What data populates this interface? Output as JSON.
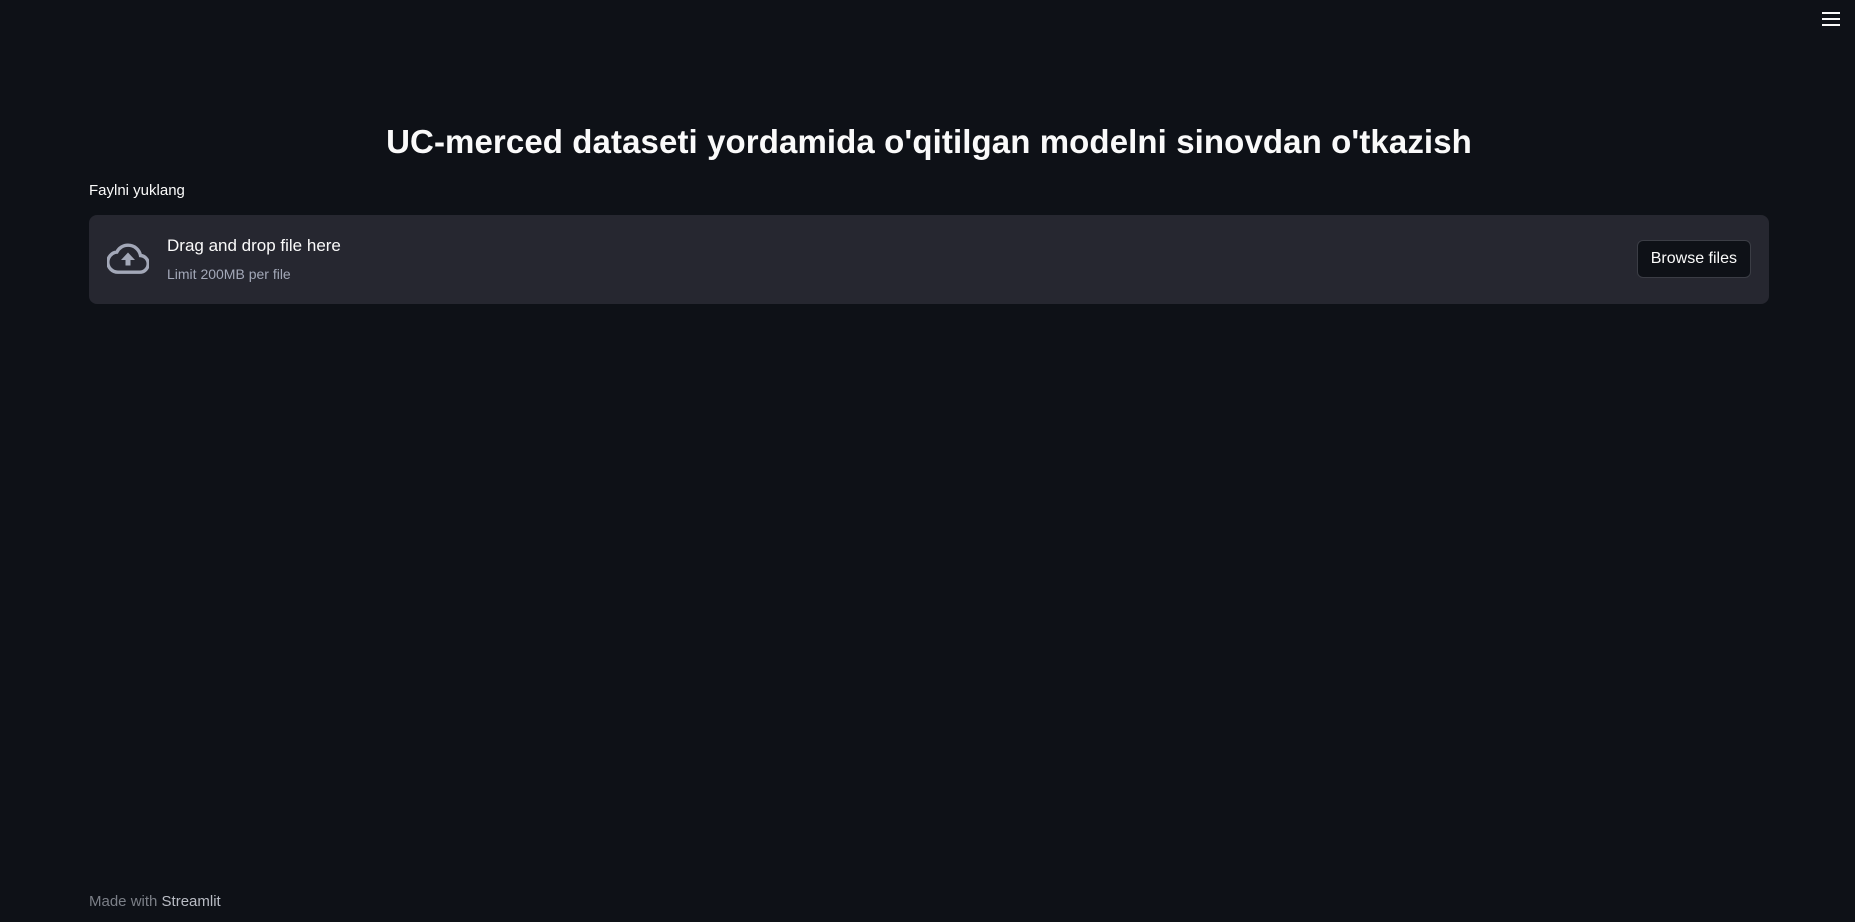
{
  "header": {
    "menu_icon": "hamburger-menu-icon"
  },
  "main": {
    "title": "UC-merced dataseti yordamida o'qitilgan modelni sinovdan o'tkazish",
    "uploader": {
      "label": "Faylni yuklang",
      "icon": "cloud-upload-icon",
      "instruction": "Drag and drop file here",
      "limit": "Limit 200MB per file",
      "browse_label": "Browse files"
    }
  },
  "footer": {
    "prefix": "Made with",
    "brand": "Streamlit"
  },
  "colors": {
    "background": "#0e1117",
    "dropzone": "#262730",
    "text": "#fafafa",
    "muted": "#a3a8b8"
  }
}
